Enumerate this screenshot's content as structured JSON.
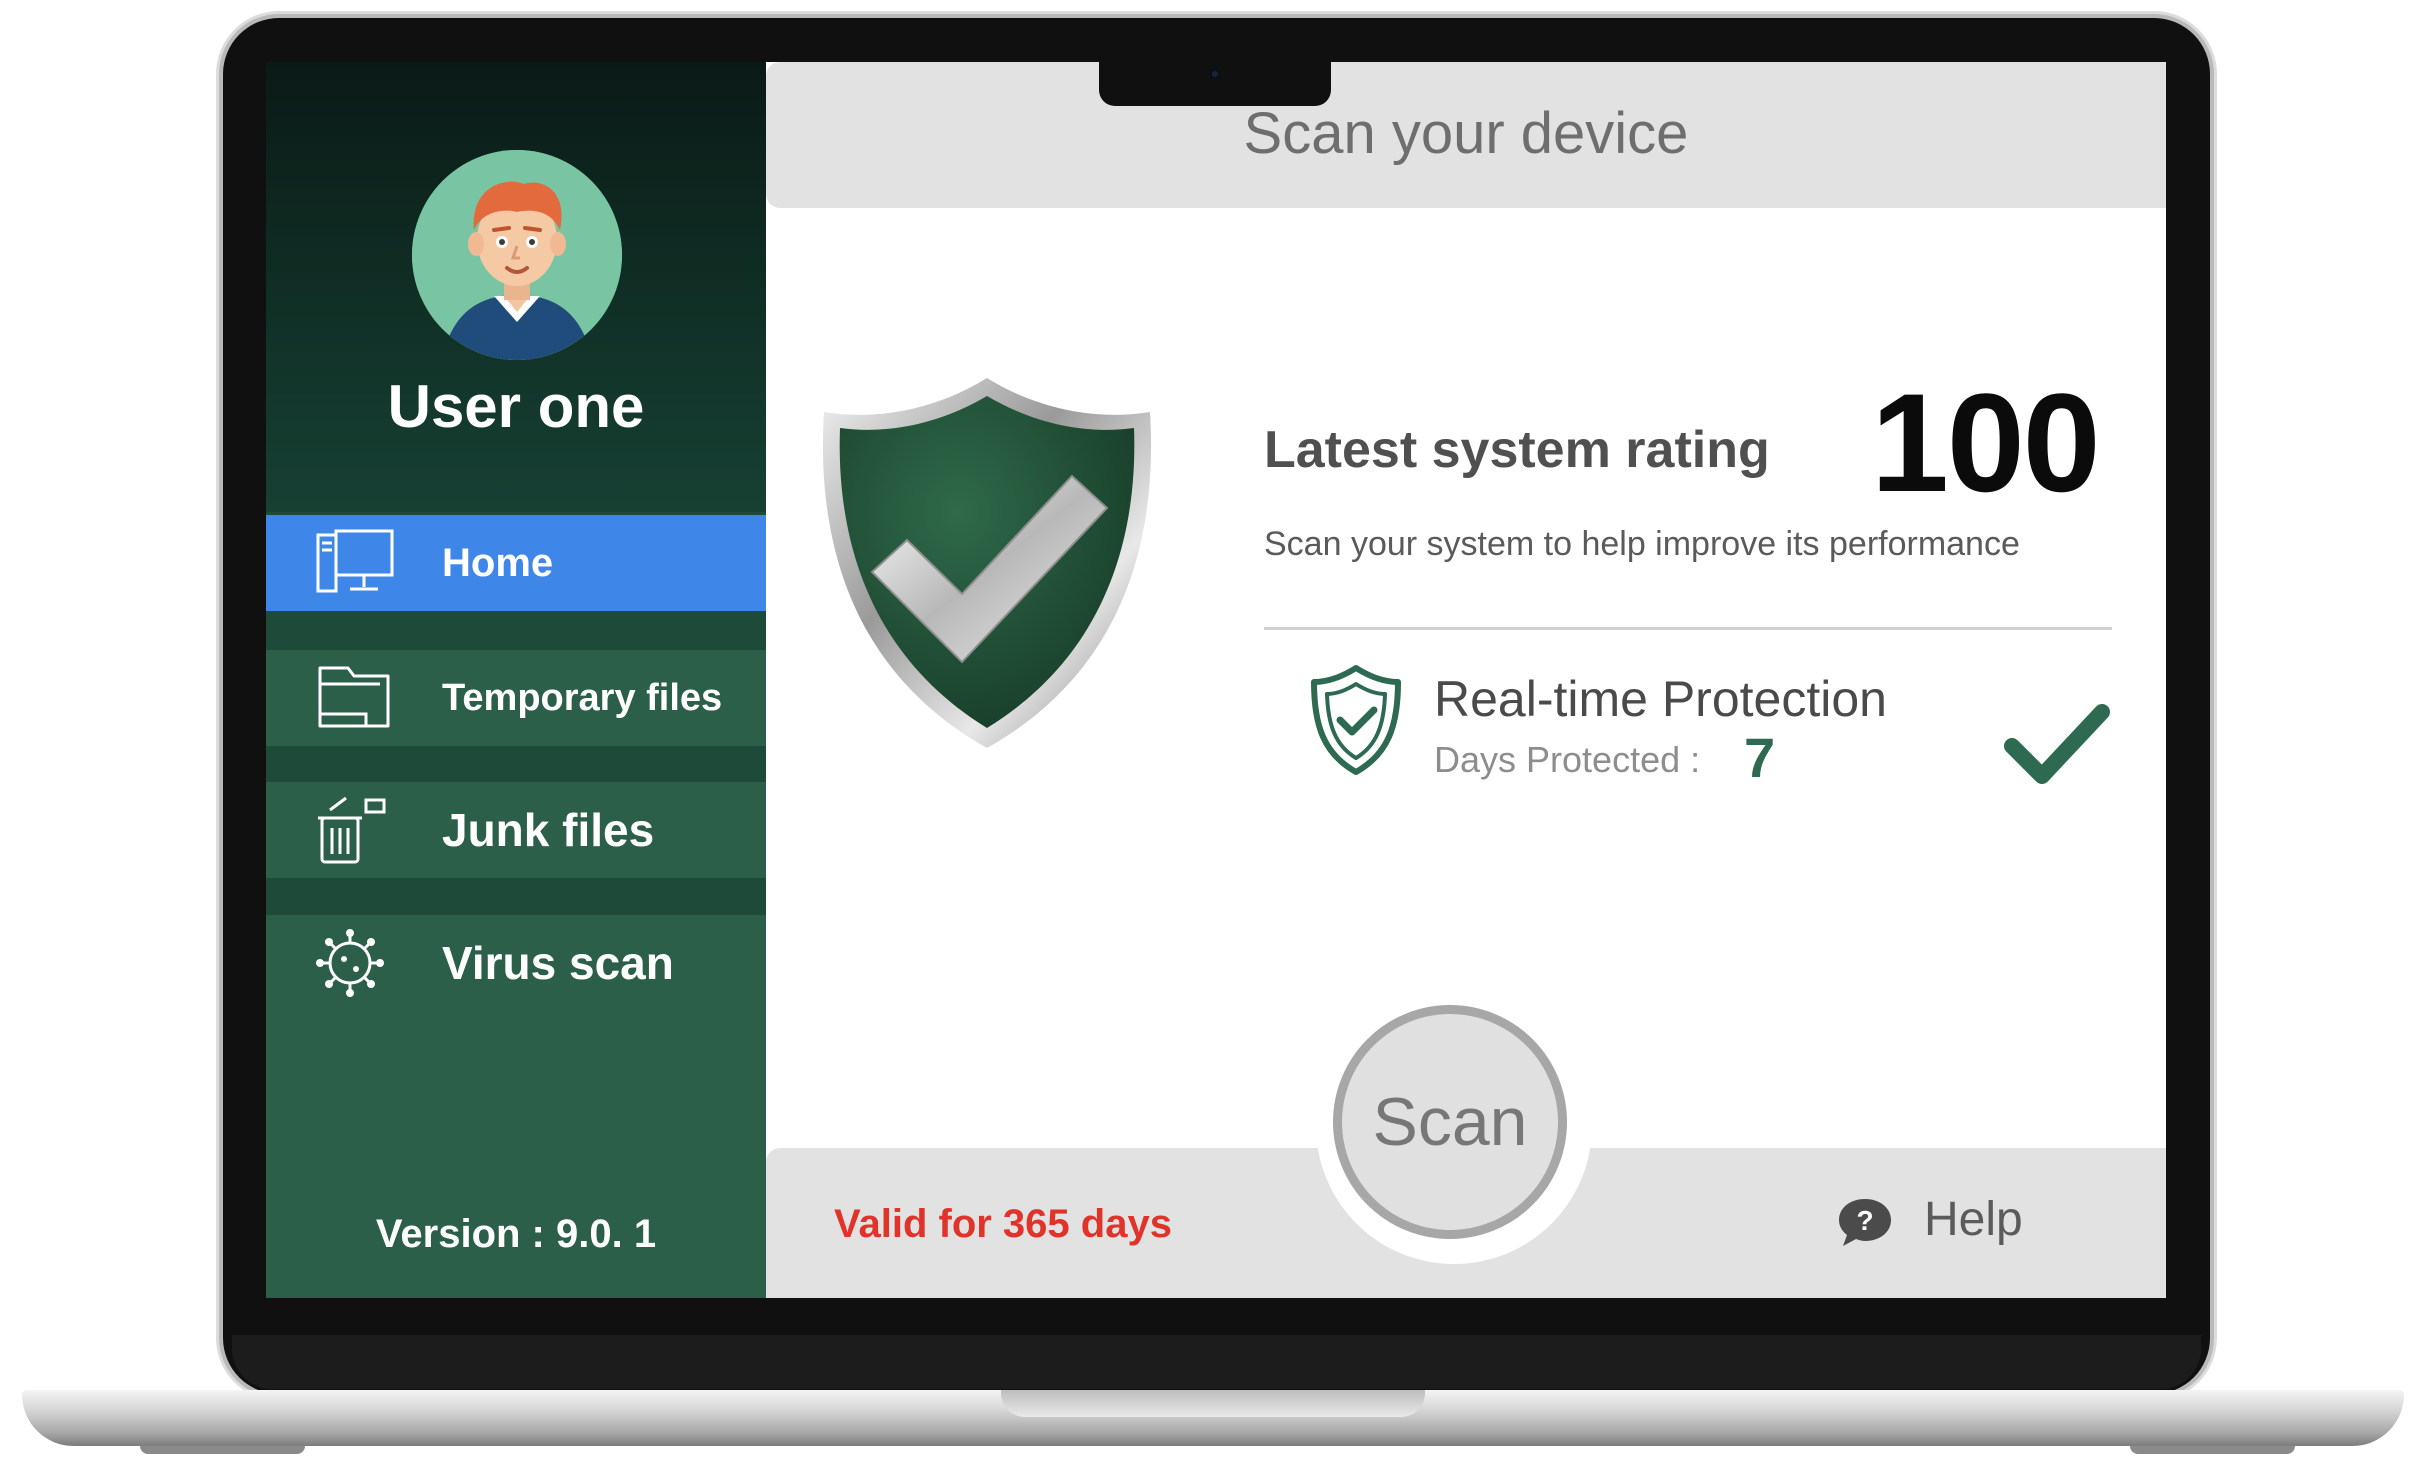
{
  "user": {
    "name": "User one"
  },
  "sidebar": {
    "items": [
      {
        "label": "Home",
        "icon": "monitor-icon",
        "active": true
      },
      {
        "label": "Temporary files",
        "icon": "folder-icon",
        "active": false
      },
      {
        "label": "Junk files",
        "icon": "trash-icon",
        "active": false
      },
      {
        "label": "Virus scan",
        "icon": "virus-icon",
        "active": false
      }
    ],
    "version": "Version : 9.0. 1"
  },
  "header": {
    "title": "Scan your device"
  },
  "rating": {
    "label": "Latest system rating",
    "value": "100",
    "subtitle": "Scan your system to help improve its performance"
  },
  "protection": {
    "title": "Real-time Protection",
    "days_label": "Days Protected :",
    "days_value": "7"
  },
  "footer": {
    "valid_text": "Valid for 365 days",
    "scan_label": "Scan",
    "help_label": "Help",
    "help_glyph": "?"
  },
  "colors": {
    "sidebar_green": "#2c5f4a",
    "active_blue": "#3e87e9",
    "valid_red": "#e0332a",
    "check_green": "#2d6a51"
  }
}
